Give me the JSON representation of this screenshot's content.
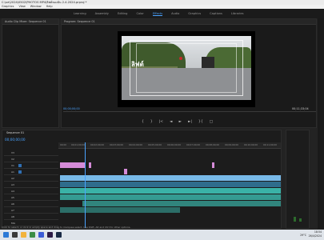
{
  "app": {
    "title": "C:\\ue\\2024\\0502\\PHOTOS MP4\\ลิฟต์ของฉัน 2.4.2024.prproj *",
    "menu": [
      "Graphics",
      "View",
      "Window",
      "Help"
    ]
  },
  "workspaces": [
    "Learning",
    "Assembly",
    "Editing",
    "Color",
    "Effects",
    "Audio",
    "Graphics",
    "Captions",
    "Libraries"
  ],
  "active_workspace": "Effects",
  "source_panel": {
    "title": "Audio Clip Mixer: Sequence 01"
  },
  "program_panel": {
    "title": "Program: Sequence 01",
    "timecode_left": "00;00;00;00",
    "timecode_right": "00;11;33;04",
    "video_logo": "ลิฟต์"
  },
  "transport": [
    "{",
    "}",
    "|<",
    "◄",
    "►",
    "►|",
    "}{",
    "□"
  ],
  "sequence": {
    "tab": "Sequence 01",
    "timecode": "00;00;00;00",
    "ruler": [
      "00;00",
      "00;01;00;00",
      "00;02;00;00",
      "00;03;00;00",
      "00;04;00;00",
      "00;05;00;00",
      "00;06;00;00",
      "00;07;00;00",
      "00;08;00;00",
      "00;09;00;00",
      "00;10;00;00",
      "00;11;00;00"
    ],
    "tracks": [
      "V3",
      "V2",
      "V1",
      "A1",
      "A2",
      "A3",
      "A4",
      "A5",
      "A6",
      "A7",
      "A8",
      "Mix"
    ]
  },
  "status_text": "Click to select, or click in empty space and drag to marquee select. Use Shift, Alt and Ctrl for other options.",
  "taskbar": {
    "time": "18:54",
    "date": "26/4/2024",
    "weather": "29°C"
  },
  "colors": {
    "accent": "#4aa3ff",
    "video_clip": "#d58bd8",
    "audio_clip": "#3ab2a7"
  }
}
